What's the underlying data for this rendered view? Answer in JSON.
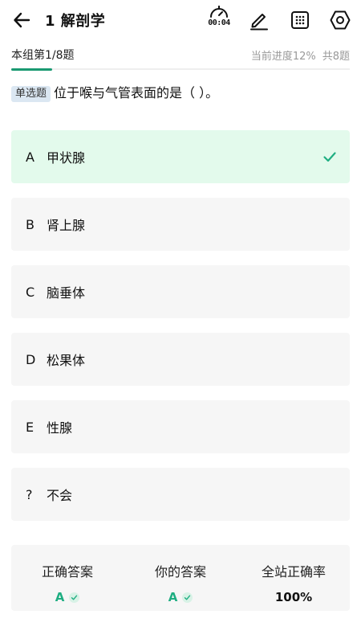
{
  "header": {
    "title": "1 解剖学",
    "timer": "00:04"
  },
  "progress": {
    "group_label": "本组第1/8题",
    "current_progress": "当前进度12%",
    "total": "共8题",
    "fraction": 0.12
  },
  "question": {
    "type_badge": "单选题",
    "text": "位于喉与气管表面的是（ ）。"
  },
  "options": [
    {
      "letter": "A",
      "text": "甲状腺",
      "state": "correct"
    },
    {
      "letter": "B",
      "text": "肾上腺",
      "state": "normal"
    },
    {
      "letter": "C",
      "text": "脑垂体",
      "state": "normal"
    },
    {
      "letter": "D",
      "text": "松果体",
      "state": "normal"
    },
    {
      "letter": "E",
      "text": "性腺",
      "state": "normal"
    },
    {
      "letter": "?",
      "text": "不会",
      "state": "normal"
    }
  ],
  "stats": {
    "correct_answer_label": "正确答案",
    "correct_answer_value": "A",
    "your_answer_label": "你的答案",
    "your_answer_value": "A",
    "site_accuracy_label": "全站正确率",
    "site_accuracy_value": "100%"
  },
  "colors": {
    "accent": "#1a9a72",
    "correct_bg": "#e3faec",
    "option_bg": "#f6f6f6",
    "badge_bg": "#dbe7f2"
  },
  "icons": [
    "back-arrow-icon",
    "stopwatch-icon",
    "pen-icon",
    "grid-icon",
    "hexagon-settings-icon",
    "check-icon"
  ]
}
